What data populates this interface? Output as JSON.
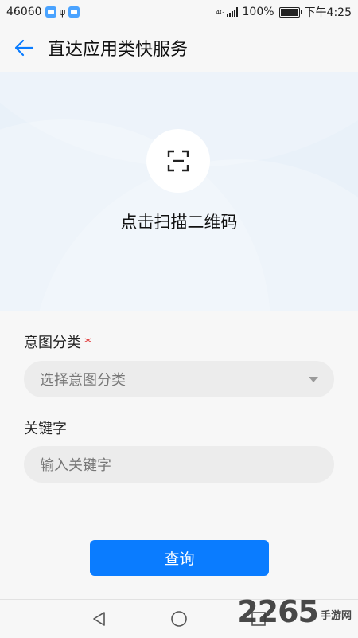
{
  "status_bar": {
    "carrier_code": "46060",
    "network": "4G",
    "battery": "100%",
    "time": "下午4:25"
  },
  "app_bar": {
    "title": "直达应用类快服务"
  },
  "scan": {
    "label": "点击扫描二维码"
  },
  "form": {
    "intent": {
      "label": "意图分类",
      "required_mark": "*",
      "placeholder": "选择意图分类"
    },
    "keyword": {
      "label": "关键字",
      "placeholder": "输入关键字"
    }
  },
  "query_button": {
    "label": "查询"
  },
  "watermark": {
    "number": "2265",
    "text": "手游网"
  },
  "colors": {
    "accent": "#0a7cff",
    "required": "#e03434",
    "banner_bg": "#e9f1f9"
  }
}
